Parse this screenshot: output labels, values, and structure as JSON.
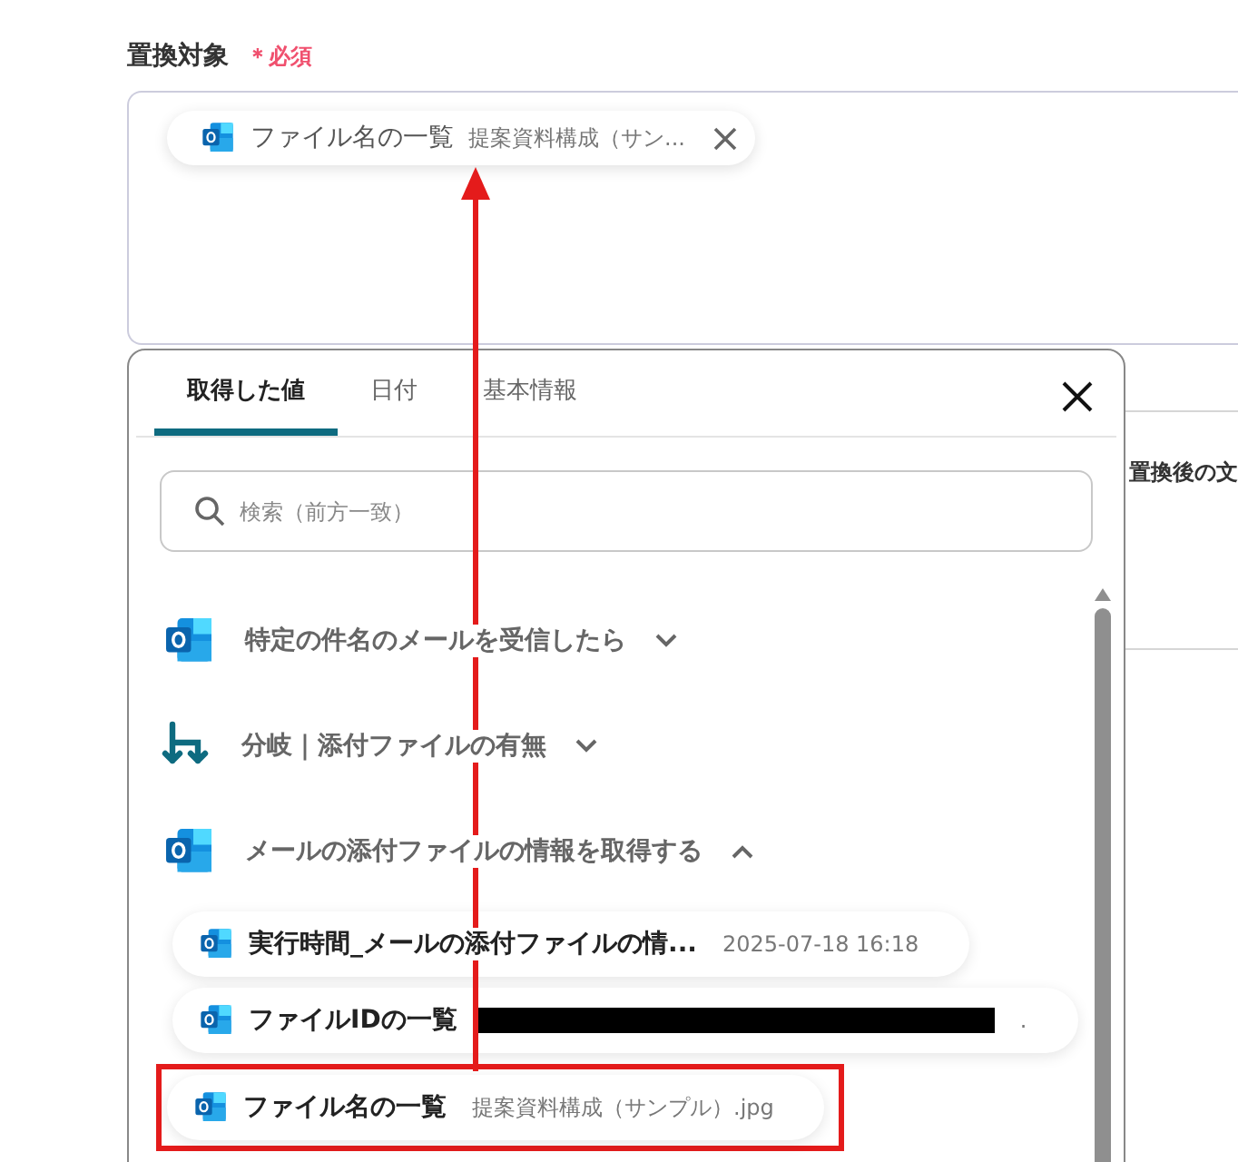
{
  "field": {
    "label": "置換対象",
    "required": "＊必須",
    "chip": {
      "name": "ファイル名の一覧",
      "value": "提案資料構成（サン..."
    }
  },
  "behind": {
    "label": "置換後の文"
  },
  "popup": {
    "tabs": [
      {
        "label": "取得した値",
        "selected": true
      },
      {
        "label": "日付",
        "selected": false
      },
      {
        "label": "基本情報",
        "selected": false
      }
    ],
    "search": {
      "placeholder": "検索（前方一致）"
    },
    "groups": [
      {
        "kind": "outlook",
        "title": "特定の件名のメールを受信したら",
        "expanded": false
      },
      {
        "kind": "branch",
        "title": "分岐｜添付ファイルの有無",
        "expanded": false
      },
      {
        "kind": "outlook",
        "title": "メールの添付ファイルの情報を取得する",
        "expanded": true,
        "items": [
          {
            "name": "実行時間_メールの添付ファイルの情...",
            "value": "2025-07-18 16:18",
            "redacted": false,
            "highlighted": false
          },
          {
            "name": "ファイルIDの一覧",
            "value": ".",
            "redacted": true,
            "highlighted": false
          },
          {
            "name": "ファイル名の一覧",
            "value": "提案資料構成（サンプル）.jpg",
            "redacted": false,
            "highlighted": true
          }
        ]
      }
    ]
  }
}
